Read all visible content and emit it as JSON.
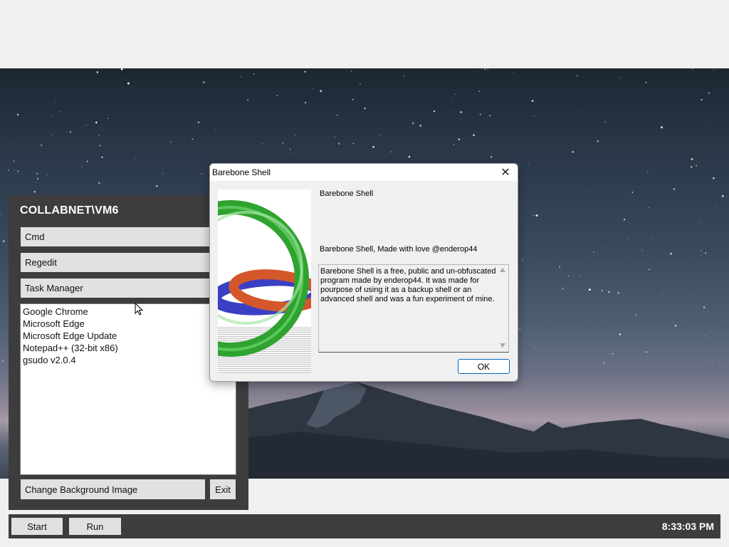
{
  "shell": {
    "title": "COLLABNET\\VM6",
    "buttons": [
      "Cmd",
      "Regedit",
      "Task Manager"
    ],
    "programs": [
      "Google Chrome",
      "Microsoft Edge",
      "Microsoft Edge Update",
      "Notepad++ (32-bit x86)",
      "gsudo v2.0.4"
    ],
    "change_bg_label": "Change Background Image",
    "exit_label": "Exit"
  },
  "taskbar": {
    "start_label": "Start",
    "run_label": "Run",
    "clock": "8:33:03 PM"
  },
  "dialog": {
    "title": "Barebone Shell",
    "close_glyph": "✕",
    "app_name": "Barebone Shell",
    "made_by": "Barebone Shell, Made with love @enderop44",
    "description": "Barebone Shell is a free, public and un-obfuscated program made by enderop44. It was made for pourpose of using it as a backup shell or an advanced shell and was a fun experiment of mine.",
    "ok_label": "OK"
  },
  "icons": {
    "logo": "three-rings-logo",
    "cursor": "mouse-pointer-icon",
    "close": "close-icon"
  },
  "colors": {
    "panel": "#3d3d3d",
    "button": "#e1e1e1",
    "ok_border": "#0067c0",
    "ring_green": "#2fa32f",
    "ring_red": "#d4572c",
    "ring_blue": "#3a3fc4"
  }
}
